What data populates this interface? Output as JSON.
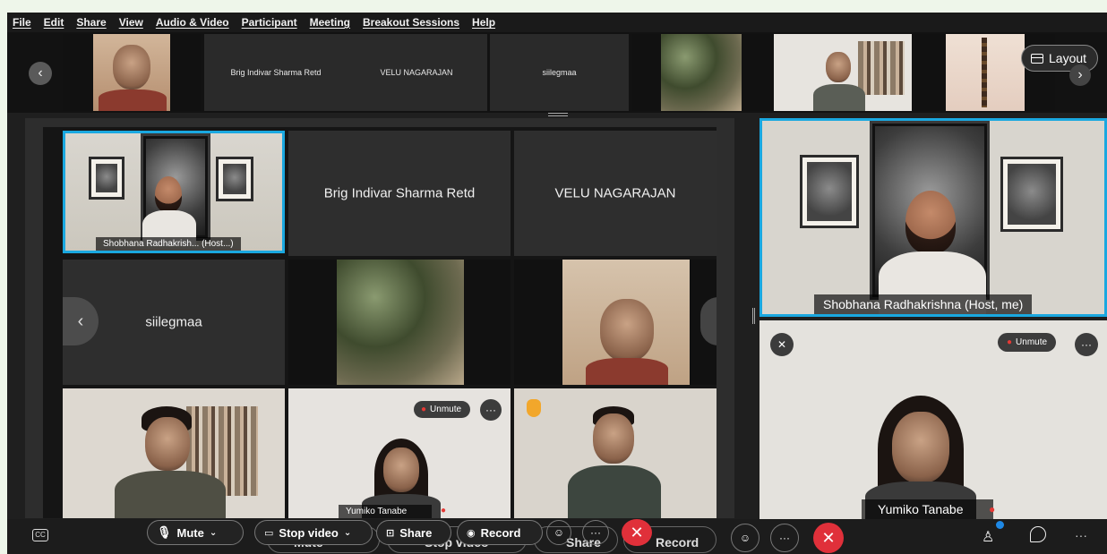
{
  "menu": [
    "File",
    "Edit",
    "Share",
    "View",
    "Audio & Video",
    "Participant",
    "Meeting",
    "Breakout Sessions",
    "Help"
  ],
  "filmstrip": {
    "names": [
      "Brig Indivar Sharma Retd",
      "VELU NAGARAJAN",
      "siilegmaa"
    ],
    "layout_label": "Layout"
  },
  "grid": {
    "host_tag": "Shobhana Radhakrish... (Host...)",
    "tile_brig": "Brig Indivar Sharma Retd",
    "tile_velu": "VELU NAGARAJAN",
    "tile_siilegmaa": "siilegmaa",
    "yumiko_tag": "Yumiko Tanabe",
    "unmute": "Unmute"
  },
  "right": {
    "host_tag": "Shobhana Radhakrishna (Host, me)",
    "yumiko_tag": "Yumiko Tanabe",
    "unmute": "Unmute"
  },
  "toolbar": {
    "mute": "Mute",
    "stop_video": "Stop video",
    "share": "Share",
    "record": "Record"
  },
  "colors": {
    "accent": "#1aa8e0",
    "end_call": "#e0303a",
    "muted_mic": "#e53935"
  }
}
